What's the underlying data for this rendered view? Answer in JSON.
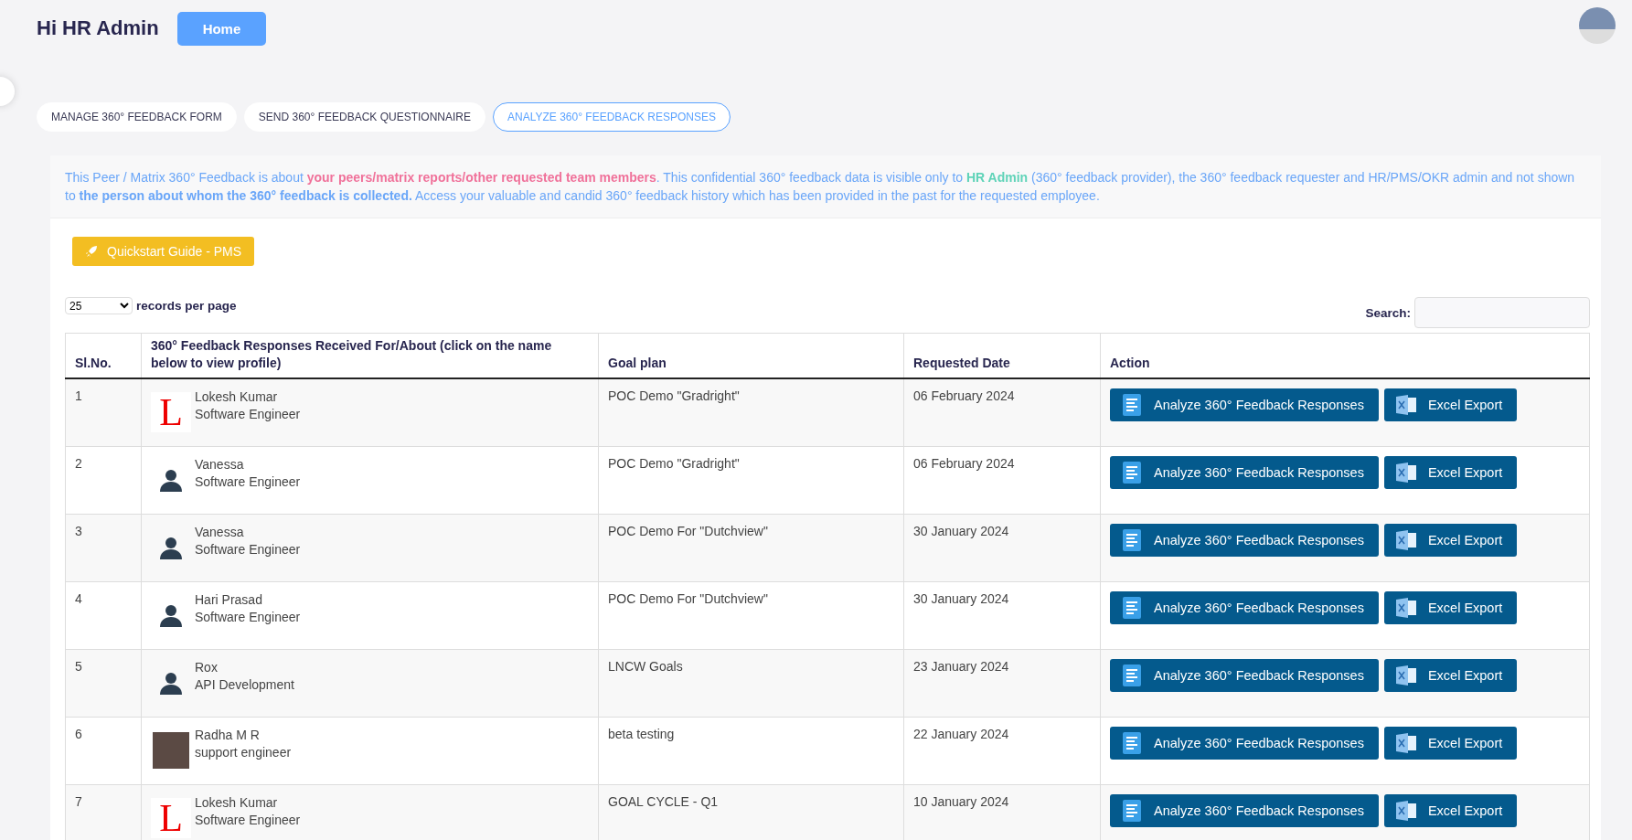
{
  "header": {
    "greeting": "Hi HR Admin",
    "home_button": "Home"
  },
  "tabs": [
    {
      "label": "MANAGE 360° FEEDBACK FORM",
      "selected": false
    },
    {
      "label": "SEND 360° FEEDBACK QUESTIONNAIRE",
      "selected": false
    },
    {
      "label": "ANALYZE 360° FEEDBACK RESPONSES",
      "selected": true
    }
  ],
  "info_text": "This Peer / Matrix 360° Feedback is about **your peers/matrix reports/other requested team members**. This confidential 360° feedback data is visible only to **HR Admin** (360° feedback provider), the 360° feedback requester and HR/PMS/OKR admin and not shown to **the person about whom the 360° feedback is collected.** Access your valuable and candid 360° feedback history which has been provided in the past for the requested employee.",
  "quickstart_button": "Quickstart Guide - PMS",
  "page_size": {
    "value": "25",
    "label": "records per page"
  },
  "search": {
    "label": "Search:"
  },
  "table": {
    "columns": [
      "Sl.No.",
      "360° Feedback Responses Received For/About (click on the name below to view profile)",
      "Goal plan",
      "Requested Date",
      "Action"
    ],
    "rows": [
      {
        "no": "1",
        "avatar": {
          "kind": "letter",
          "letter": "L"
        },
        "name": "Lokesh Kumar",
        "role": "Software Engineer",
        "goal_plan": "POC Demo \"Gradright\"",
        "date": "06 February 2024",
        "actions": [
          "Analyze 360° Feedback Responses",
          "Excel Export"
        ]
      },
      {
        "no": "2",
        "avatar": {
          "kind": "person"
        },
        "name": "Vanessa",
        "role": "Software Engineer",
        "goal_plan": "POC Demo \"Gradright\"",
        "date": "06 February 2024",
        "actions": [
          "Analyze 360° Feedback Responses",
          "Excel Export"
        ]
      },
      {
        "no": "3",
        "avatar": {
          "kind": "person"
        },
        "name": "Vanessa",
        "role": "Software Engineer",
        "goal_plan": "POC Demo For \"Dutchview\"",
        "date": "30 January 2024",
        "actions": [
          "Analyze 360° Feedback Responses",
          "Excel Export"
        ]
      },
      {
        "no": "4",
        "avatar": {
          "kind": "person"
        },
        "name": "Hari Prasad",
        "role": "Software Engineer",
        "goal_plan": "POC Demo For \"Dutchview\"",
        "date": "30 January 2024",
        "actions": [
          "Analyze 360° Feedback Responses",
          "Excel Export"
        ]
      },
      {
        "no": "5",
        "avatar": {
          "kind": "person"
        },
        "name": "Rox",
        "role": "API Development",
        "goal_plan": "LNCW Goals",
        "date": "23 January 2024",
        "actions": [
          "Analyze 360° Feedback Responses",
          "Excel Export"
        ]
      },
      {
        "no": "6",
        "avatar": {
          "kind": "photo"
        },
        "name": "Radha M R",
        "role": "support engineer",
        "goal_plan": "beta testing",
        "date": "22 January 2024",
        "actions": [
          "Analyze 360° Feedback Responses",
          "Excel Export"
        ]
      },
      {
        "no": "7",
        "avatar": {
          "kind": "letter",
          "letter": "L"
        },
        "name": "Lokesh Kumar",
        "role": "Software Engineer",
        "goal_plan": "GOAL CYCLE - Q1",
        "date": "10 January 2024",
        "actions": [
          "Analyze 360° Feedback Responses",
          "Excel Export"
        ]
      }
    ]
  }
}
